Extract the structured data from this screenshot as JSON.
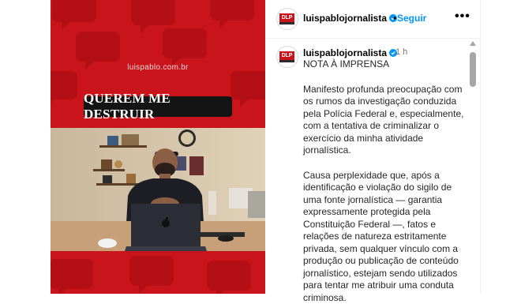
{
  "media": {
    "site": "luispablo.com.br",
    "headline": "QUEREM ME DESTRUIR"
  },
  "post": {
    "username": "luispablojornalista",
    "separator": "•",
    "follow_label": "Seguir",
    "more_label": "•••",
    "avatar_text": "DLP",
    "comment": {
      "username": "luispablojornalista",
      "time": "1 h",
      "title": "NOTA À IMPRENSA",
      "paragraph_1": "Manifesto profunda preocupação com os rumos da investigação conduzida pela Polícia Federal e, especialmente, com a tentativa de criminalizar o exercício da minha atividade jornalística.",
      "paragraph_2": "Causa perplexidade que, após a identificação e violação do sigilo de uma fonte jornalística — garantia expressamente protegida pela Constituição Federal —, fatos e relações de natureza estritamente privada, sem qualquer vínculo com a produção ou publicação de conteúdo jornalístico, estejam sendo utilizados para tentar me atribuir uma conduta criminosa."
    }
  },
  "colors": {
    "brand_red": "#c8141a",
    "follow_blue": "#0095f6",
    "verified_blue": "#0095f6"
  },
  "icons": [
    "verified-icon",
    "more-icon",
    "laptop-apple-icon"
  ]
}
